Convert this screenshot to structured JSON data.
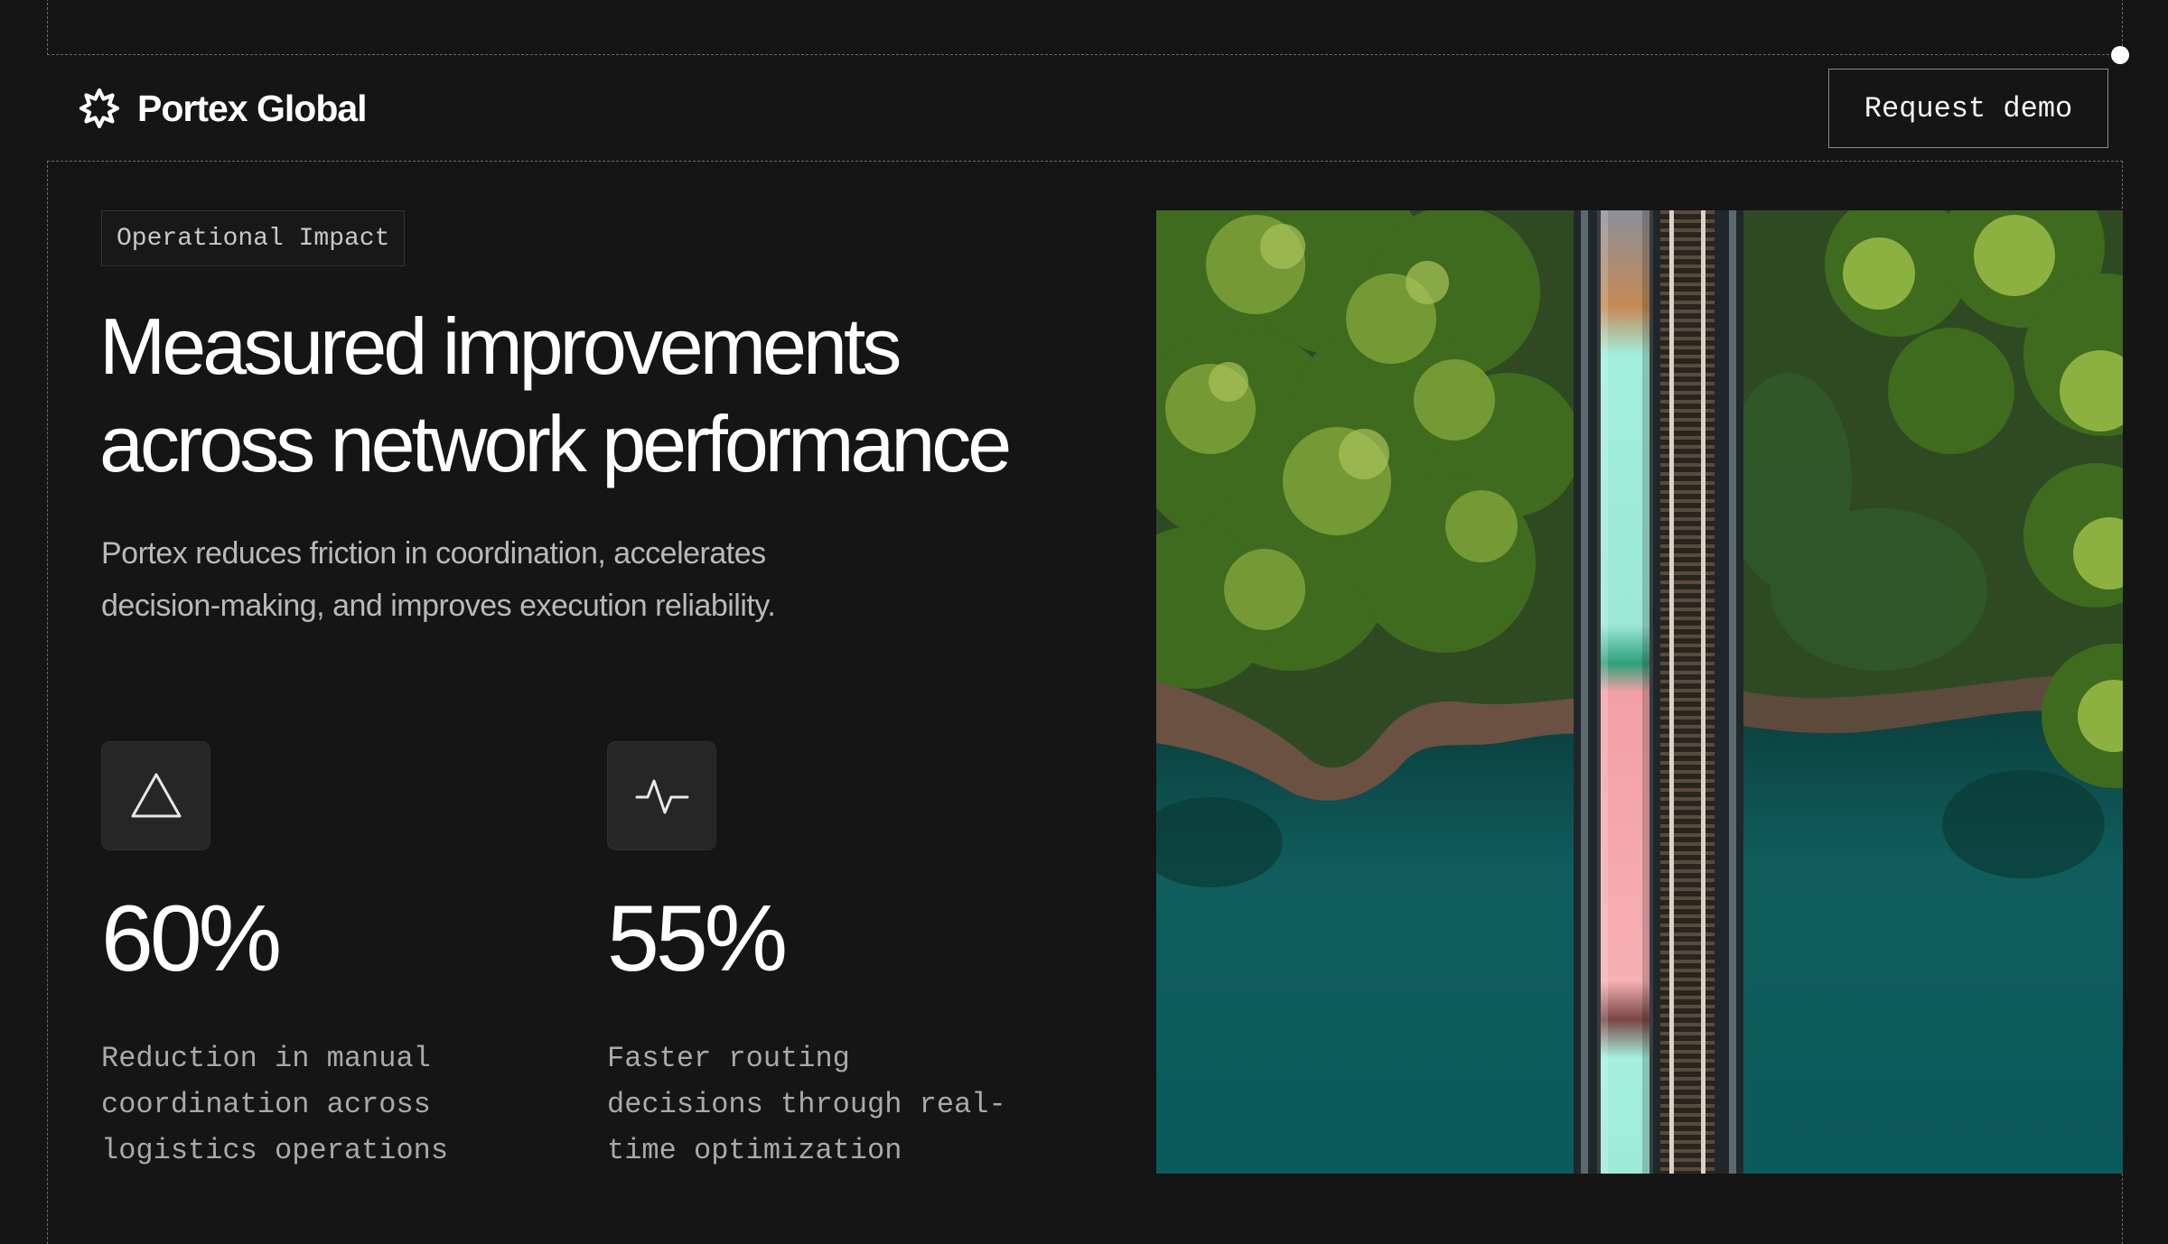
{
  "header": {
    "brand_name": "Portex Global",
    "cta_label": "Request demo"
  },
  "hero": {
    "tag": "Operational Impact",
    "headline_line1": "Measured improvements",
    "headline_line2": "across network performance",
    "subtext_line1": "Portex reduces friction in coordination, accelerates",
    "subtext_line2": "decision-making, and improves execution reliability."
  },
  "stats": [
    {
      "icon": "triangle-icon",
      "value": "60%",
      "desc_line1": "Reduction in manual",
      "desc_line2": "coordination across",
      "desc_line3": "logistics operations"
    },
    {
      "icon": "pulse-icon",
      "value": "55%",
      "desc_line1": "Faster routing",
      "desc_line2": "decisions through real-",
      "desc_line3": "time optimization"
    }
  ],
  "colors": {
    "background": "#151515",
    "text_primary": "#ffffff",
    "text_muted": "#b9b9b9",
    "icon_tile": "#262626",
    "water": "#0e5f5e",
    "trees": "#3f6b1e",
    "train_cyan": "#9ff0dc",
    "train_pink": "#f3a3a6"
  }
}
